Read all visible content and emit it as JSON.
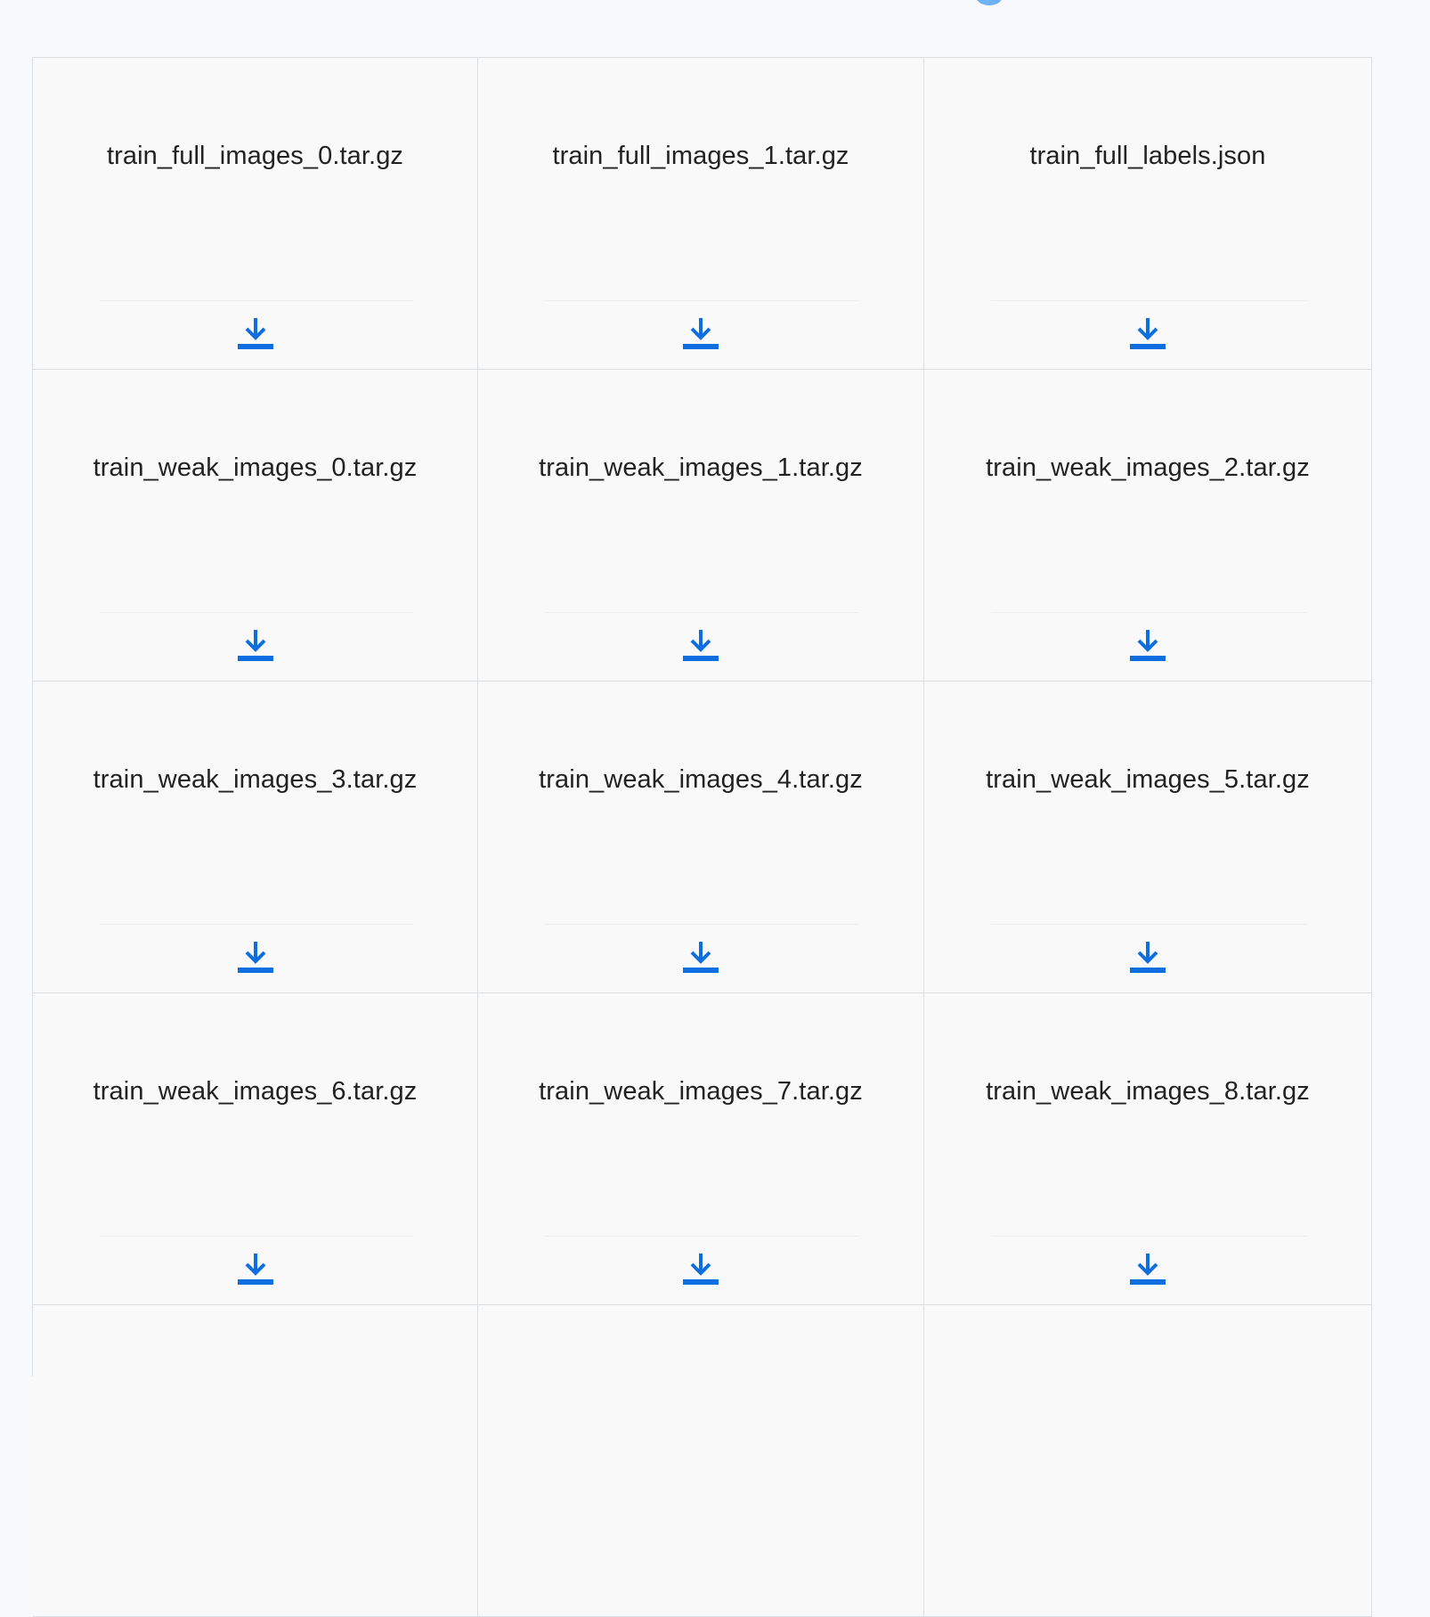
{
  "files": [
    {
      "name": "train_full_images_0.tar.gz"
    },
    {
      "name": "train_full_images_1.tar.gz"
    },
    {
      "name": "train_full_labels.json"
    },
    {
      "name": "train_weak_images_0.tar.gz"
    },
    {
      "name": "train_weak_images_1.tar.gz"
    },
    {
      "name": "train_weak_images_2.tar.gz"
    },
    {
      "name": "train_weak_images_3.tar.gz"
    },
    {
      "name": "train_weak_images_4.tar.gz"
    },
    {
      "name": "train_weak_images_5.tar.gz"
    },
    {
      "name": "train_weak_images_6.tar.gz"
    },
    {
      "name": "train_weak_images_7.tar.gz"
    },
    {
      "name": "train_weak_images_8.tar.gz"
    },
    {
      "name": ""
    },
    {
      "name": ""
    },
    {
      "name": ""
    }
  ],
  "icons": {
    "download": "download-icon",
    "top_indicator": "dot-icon"
  },
  "colors": {
    "accent": "#0d6ee0",
    "border": "#dcdfe2",
    "background": "#f8f9fa",
    "text": "#222222"
  }
}
